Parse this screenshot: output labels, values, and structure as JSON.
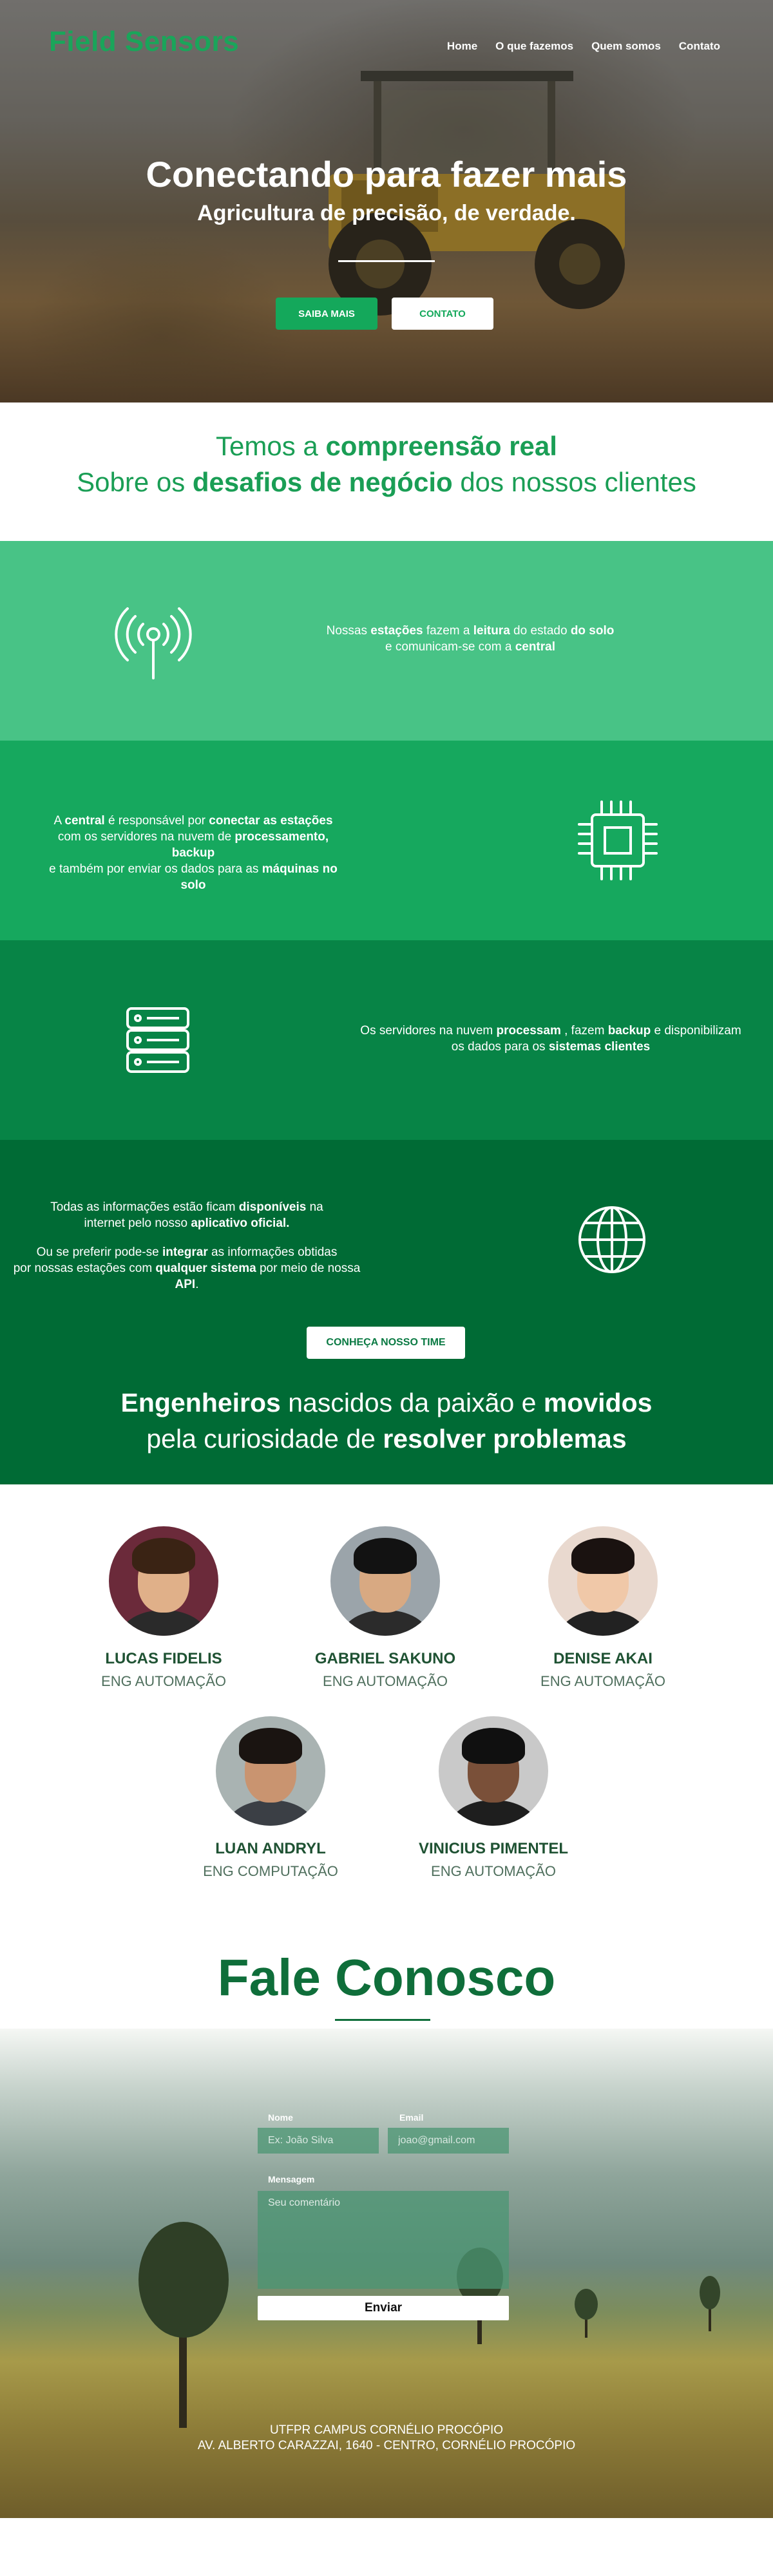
{
  "brand": {
    "name": "Field Sensors",
    "color": "#1aa55a"
  },
  "nav": {
    "items": [
      "Home",
      "O que fazemos",
      "Quem somos",
      "Contato"
    ]
  },
  "hero": {
    "title": "Conectando para fazer mais",
    "subtitle": "Agricultura de precisão, de verdade.",
    "primary_button": "SAIBA MAIS",
    "secondary_button": "CONTATO"
  },
  "intro": {
    "line1_a": "Temos a ",
    "line1_b": "compreensão real",
    "line2_a": "Sobre os ",
    "line2_b": "desafios de negócio",
    "line2_c": " dos nossos clientes"
  },
  "features": {
    "stations": {
      "icon": "antenna-icon",
      "t1": "Nossas ",
      "b1": "estações",
      "t2": " fazem a ",
      "b2": "leitura",
      "t3": " do estado ",
      "b3": "do solo",
      "t4": " e comunicam-se com a ",
      "b4": "central"
    },
    "central": {
      "icon": "chip-icon",
      "t1": "A ",
      "b1": "central",
      "t2": " é responsável por ",
      "b2": "conectar as estações",
      "t3": "com os servidores na nuvem de ",
      "b3": "processamento, backup",
      "t4": "e também por enviar os dados para as ",
      "b4": "máquinas no solo"
    },
    "servers": {
      "icon": "server-icon",
      "t1": "Os servidores na nuvem ",
      "b1": "processam",
      "t2": " , fazem ",
      "b2": "backup",
      "t3": " e disponibilizam",
      "t4": "os dados para os ",
      "b3": "sistemas clientes"
    },
    "app": {
      "icon": "globe-icon",
      "t1": "Todas as informações estão ficam ",
      "b1": "disponíveis",
      "t2": " na",
      "t3": "internet pelo nosso ",
      "b2": "aplicativo oficial.",
      "t4": "Ou se preferir pode-se ",
      "b3": "integrar",
      "t5": " as informações obtidas",
      "t6": "por nossas estações com ",
      "b4": "qualquer sistema",
      "t7": " por meio de nossa ",
      "b5": "API",
      "team_button": "CONHEÇA NOSSO TIME"
    }
  },
  "team_headline": {
    "b1": "Engenheiros",
    "t1": " nascidos da paixão e ",
    "b2": "movidos",
    "t2": "pela curiosidade de ",
    "b3": "resolver problemas"
  },
  "team": [
    {
      "name": "LUCAS FIDELIS",
      "role": "ENG AUTOMAÇÃO"
    },
    {
      "name": "GABRIEL SAKUNO",
      "role": "ENG AUTOMAÇÃO"
    },
    {
      "name": "DENISE AKAI",
      "role": "ENG AUTOMAÇÃO"
    },
    {
      "name": "LUAN ANDRYL",
      "role": "ENG COMPUTAÇÃO"
    },
    {
      "name": "VINICIUS PIMENTEL",
      "role": "ENG AUTOMAÇÃO"
    }
  ],
  "contact": {
    "title": "Fale Conosco",
    "name_label": "Nome",
    "name_placeholder": "Ex: João Silva",
    "email_label": "Email",
    "email_placeholder": "joao@gmail.com",
    "message_label": "Mensagem",
    "message_placeholder": "Seu comentário",
    "send_button": "Enviar"
  },
  "footer": {
    "line1": "UTFPR CAMPUS CORNÉLIO PROCÓPIO",
    "line2": "AV. ALBERTO CARAZZAI, 1640 - CENTRO, CORNÉLIO PROCÓPIO"
  }
}
